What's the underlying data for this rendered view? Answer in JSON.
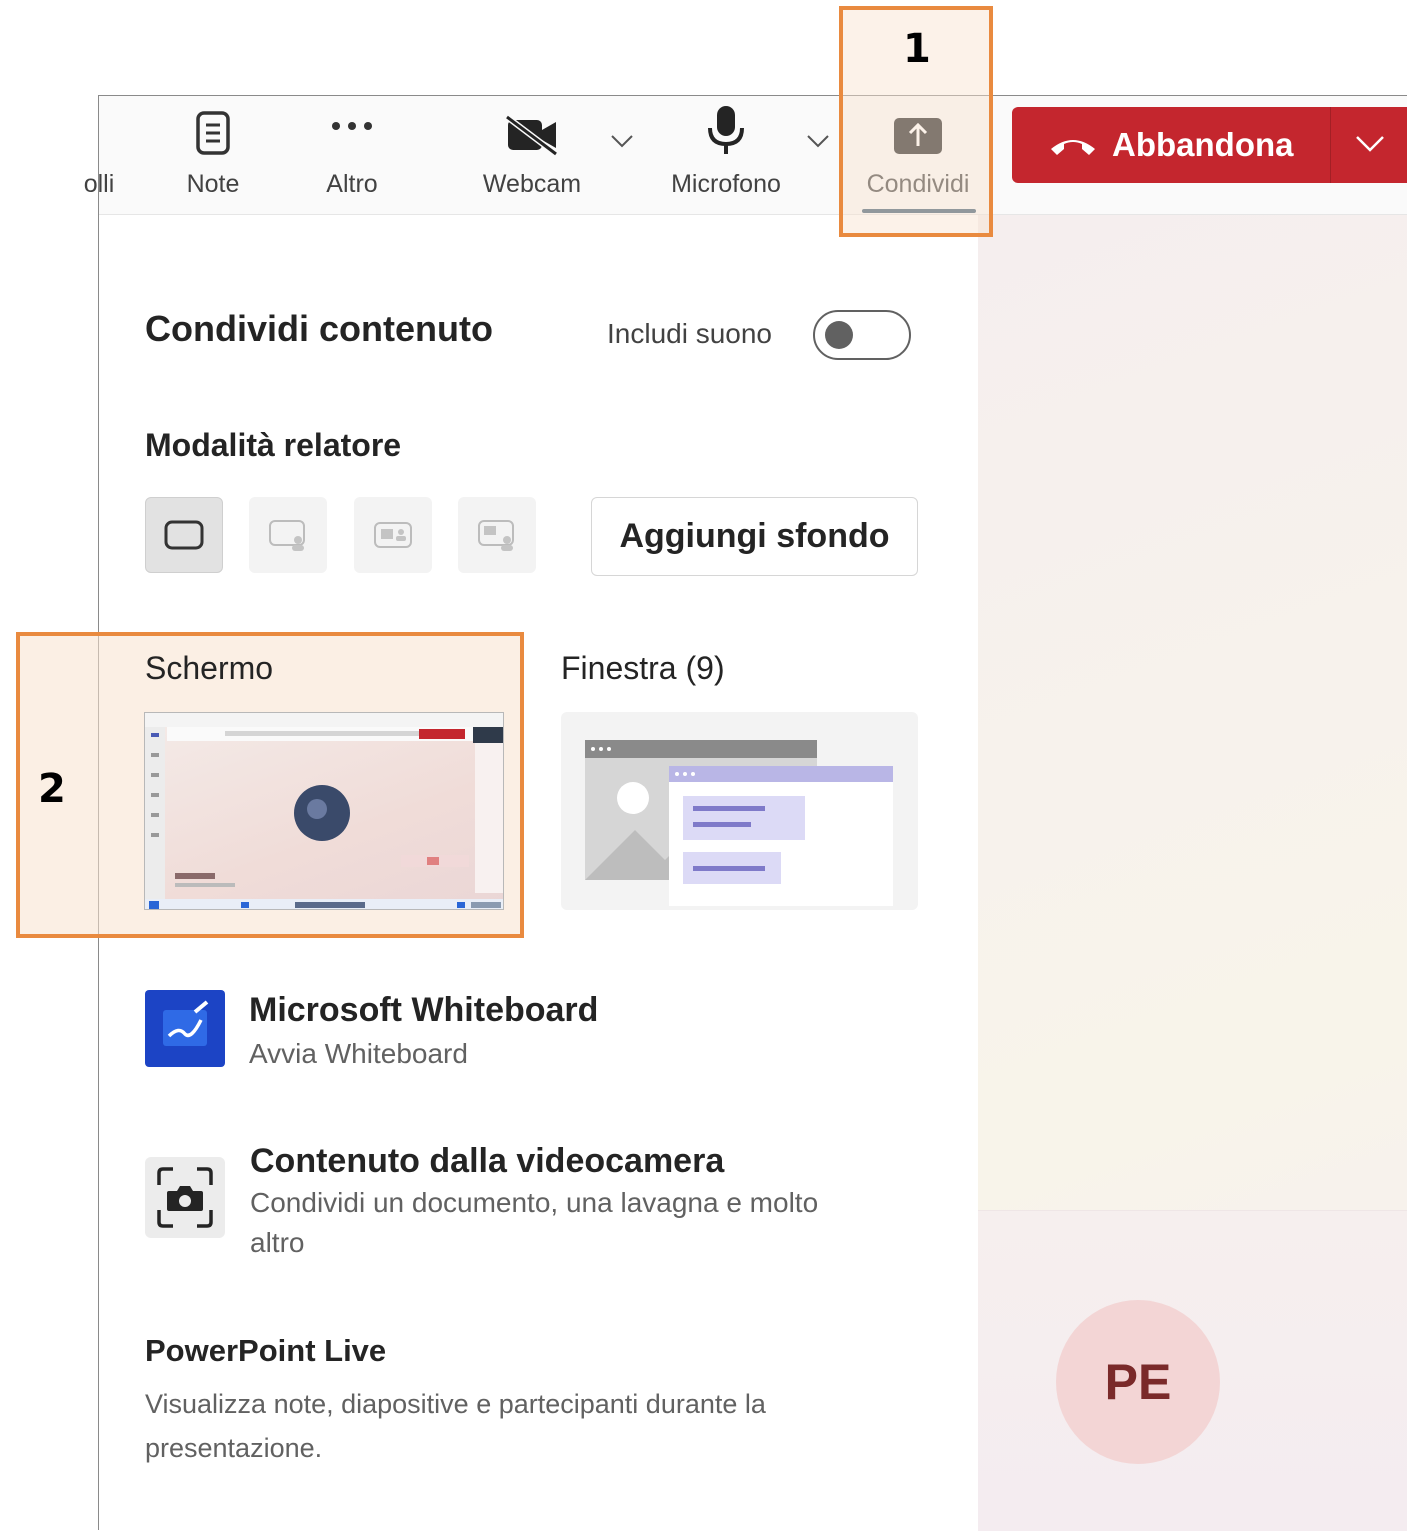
{
  "toolbar": {
    "partial_label": "olli",
    "note_label": "Note",
    "more_label": "Altro",
    "webcam_label": "Webcam",
    "mic_label": "Microfono",
    "share_label": "Condividi",
    "hangup_label": "Abbandona"
  },
  "callouts": {
    "one": "1",
    "two": "2"
  },
  "panel": {
    "title": "Condividi contenuto",
    "include_sound_label": "Includi suono",
    "include_sound_on": false,
    "presenter_mode_label": "Modalità relatore",
    "add_background_label": "Aggiungi sfondo",
    "screen_label": "Schermo",
    "window_label": "Finestra (9)",
    "whiteboard": {
      "title": "Microsoft Whiteboard",
      "subtitle": "Avvia Whiteboard"
    },
    "camera": {
      "title": "Contenuto dalla videocamera",
      "subtitle_line1": "Condividi un documento, una lavagna e molto",
      "subtitle_line2": "altro"
    },
    "powerpoint": {
      "title": "PowerPoint Live",
      "subtitle_line1": "Visualizza note, diapositive e partecipanti durante la",
      "subtitle_line2": "presentazione."
    }
  },
  "stage": {
    "avatar_initials": "PE"
  },
  "colors": {
    "hangup": "#c4262e",
    "highlight": "#e98a3f",
    "whiteboard": "#1c44c5",
    "accent": "#3d5b73"
  }
}
